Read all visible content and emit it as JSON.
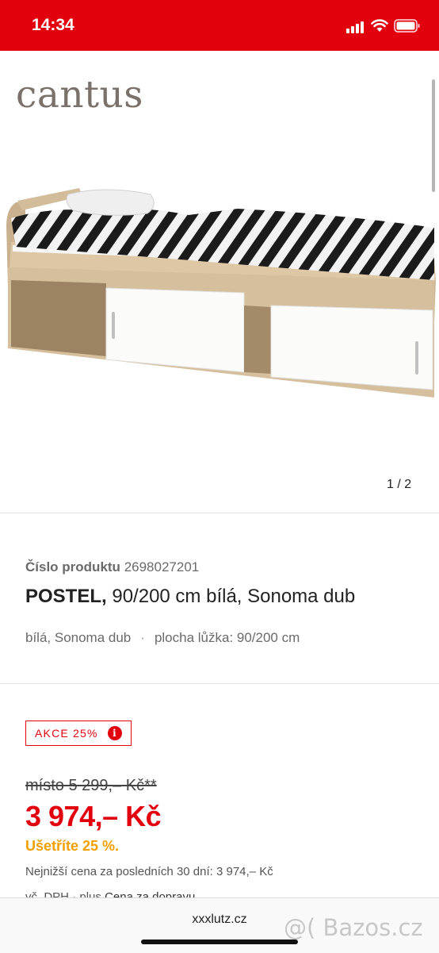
{
  "status": {
    "time": "14:34"
  },
  "brand": "cantus",
  "gallery": {
    "counter": "1 / 2"
  },
  "product": {
    "number_label": "Číslo produktu",
    "number": "2698027201",
    "name": "POSTEL,",
    "description": "90/200 cm bílá, Sonoma dub",
    "attribute_1": "bílá, Sonoma dub",
    "separator": "·",
    "attribute_2": "plocha lůžka: 90/200 cm"
  },
  "pricing": {
    "badge": "AKCE 25%",
    "badge_info": "i",
    "old_price": "místo 5 299,– Kč**",
    "new_price": "3 974,– Kč",
    "savings": "Ušetříte 25 %.",
    "lowest_price": "Nejnižší cena za posledních 30 dní: 3 974,– Kč",
    "vat": "vč. DPH",
    "vat_sep": "·",
    "shipping_prefix": "plus",
    "shipping_link": "Cena za dopravu"
  },
  "browser": {
    "url": "xxxlutz.cz"
  },
  "watermark": "@( Bazos.cz",
  "colors": {
    "accent": "#e2000f",
    "savings": "#f2a000"
  }
}
